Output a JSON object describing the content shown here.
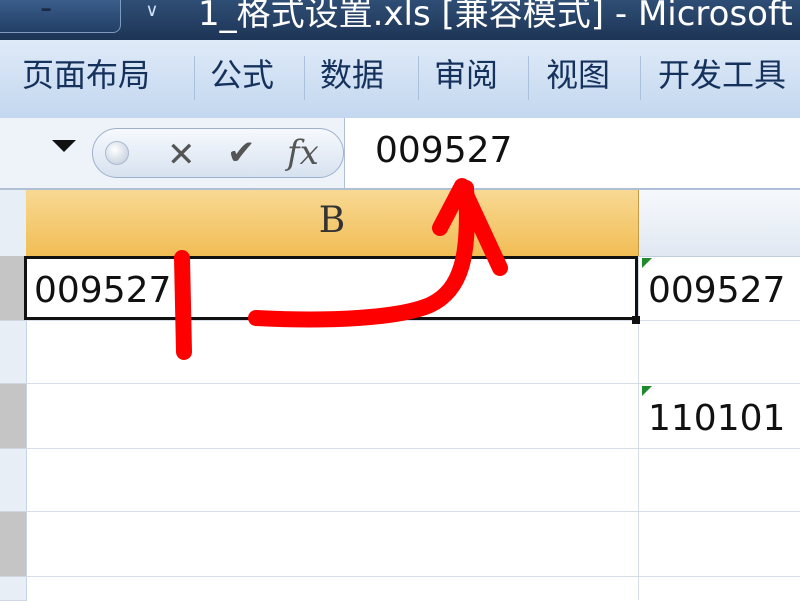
{
  "titlebar": {
    "button_text": "-",
    "dropdown_glyph": "∨",
    "title": "1_格式设置.xls  [兼容模式] - Microsoft"
  },
  "ribbon": {
    "tabs": [
      {
        "label": "页面布局"
      },
      {
        "label": "公式"
      },
      {
        "label": "数据"
      },
      {
        "label": "审阅"
      },
      {
        "label": "视图"
      },
      {
        "label": "开发工具"
      }
    ]
  },
  "formula_bar": {
    "cancel_glyph": "✕",
    "enter_glyph": "✔",
    "fx_label": "fx",
    "value": "009527"
  },
  "sheet": {
    "column_b_label": "B",
    "cells": {
      "b_row1": "009527",
      "c_row1": "009527",
      "c_row3": "110101"
    }
  },
  "colors": {
    "column_header_active": "#f1bd55",
    "annotation_red": "#ff0000",
    "error_triangle": "#1e8a2c"
  }
}
